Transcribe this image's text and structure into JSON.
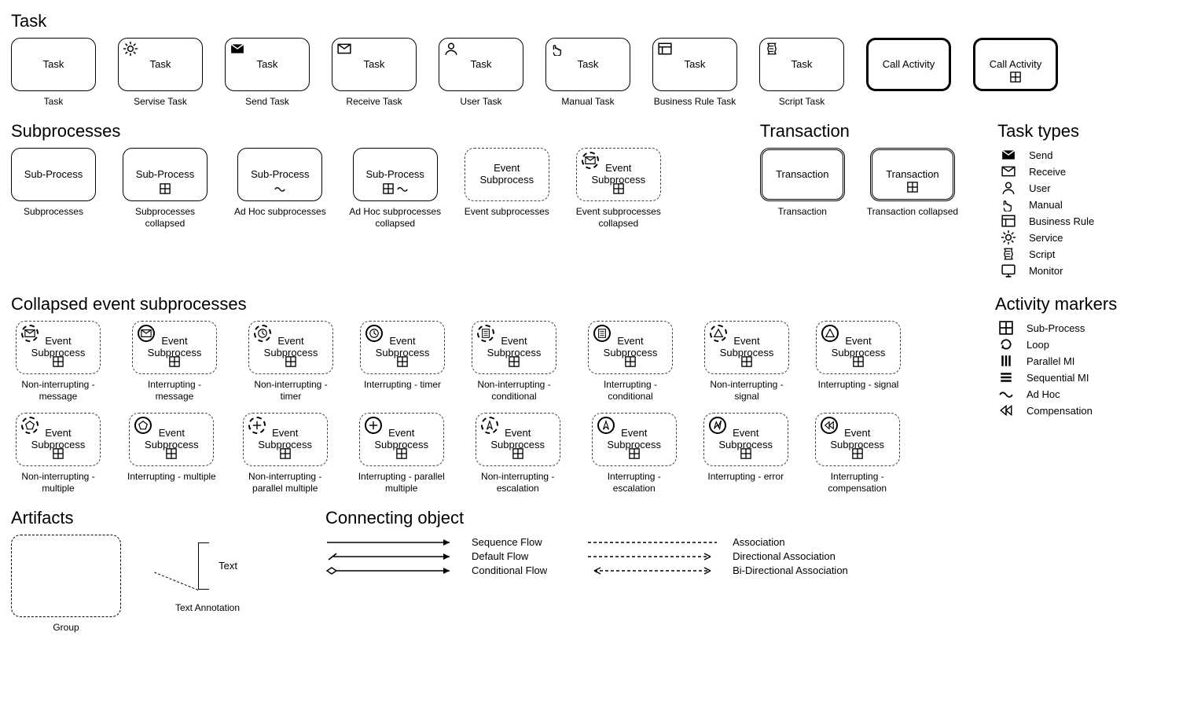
{
  "sections": {
    "task_title": "Task",
    "subprocesses_title": "Subprocesses",
    "transaction_title": "Transaction",
    "task_types_title": "Task types",
    "collapsed_title": "Collapsed event subprocesses",
    "activity_markers_title": "Activity markers",
    "artifacts_title": "Artifacts",
    "connecting_title": "Connecting object"
  },
  "tasks": [
    {
      "label": "Task",
      "caption": "Task"
    },
    {
      "label": "Task",
      "caption": "Servise Task"
    },
    {
      "label": "Task",
      "caption": "Send Task"
    },
    {
      "label": "Task",
      "caption": "Receive Task"
    },
    {
      "label": "Task",
      "caption": "User Task"
    },
    {
      "label": "Task",
      "caption": "Manual Task"
    },
    {
      "label": "Task",
      "caption": "Business Rule Task"
    },
    {
      "label": "Task",
      "caption": "Script Task"
    },
    {
      "label": "Call Activity",
      "caption": ""
    },
    {
      "label": "Call Activity",
      "caption": ""
    }
  ],
  "subprocesses": [
    {
      "label": "Sub-Process",
      "caption": "Subprocesses"
    },
    {
      "label": "Sub-Process",
      "caption": "Subprocesses collapsed"
    },
    {
      "label": "Sub-Process",
      "caption": "Ad Hoc subprocesses"
    },
    {
      "label": "Sub-Process",
      "caption": "Ad Hoc subprocesses collapsed"
    },
    {
      "label": "Event Subprocess",
      "caption": "Event subprocesses"
    },
    {
      "label": "Event Subprocess",
      "caption": "Event subprocesses collapsed"
    }
  ],
  "transactions": [
    {
      "label": "Transaction",
      "caption": "Transaction"
    },
    {
      "label": "Transaction",
      "caption": "Transaction collapsed"
    }
  ],
  "task_types": [
    "Send",
    "Receive",
    "User",
    "Manual",
    "Business Rule",
    "Service",
    "Script",
    "Monitor"
  ],
  "collapsed1": [
    {
      "caption": "Non-interrupting - message"
    },
    {
      "caption": "Interrupting - message"
    },
    {
      "caption": "Non-interrupting - timer"
    },
    {
      "caption": "Interrupting - timer"
    },
    {
      "caption": "Non-interrupting - conditional"
    },
    {
      "caption": "Interrupting - conditional"
    },
    {
      "caption": "Non-interrupting - signal"
    },
    {
      "caption": "Interrupting - signal"
    }
  ],
  "collapsed2": [
    {
      "caption": "Non-interrupting - multiple"
    },
    {
      "caption": "Interrupting - multiple"
    },
    {
      "caption": "Non-interrupting - parallel multiple"
    },
    {
      "caption": "Interrupting - parallel multiple"
    },
    {
      "caption": "Non-interrupting - escalation"
    },
    {
      "caption": "Interrupting - escalation"
    },
    {
      "caption": "Interrupting - error"
    },
    {
      "caption": "Interrupting - compensation"
    }
  ],
  "collapsed_label": "Event Subprocess",
  "activity_markers": [
    "Sub-Process",
    "Loop",
    "Parallel MI",
    "Sequential MI",
    "Ad Hoc",
    "Compensation"
  ],
  "artifacts": {
    "group": "Group",
    "text_annotation_label": "Text Annotation",
    "text_annotation_text": "Text"
  },
  "connecting": {
    "left": [
      "Sequence Flow",
      "Default Flow",
      "Conditional Flow"
    ],
    "right": [
      "Association",
      "Directional Association",
      "Bi-Directional Association"
    ]
  }
}
